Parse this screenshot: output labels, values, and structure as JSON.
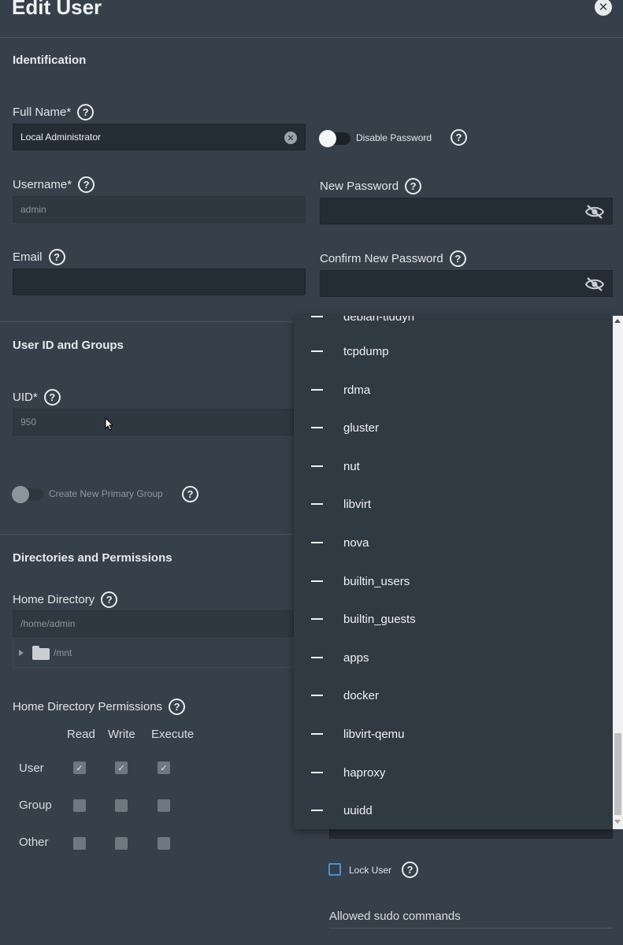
{
  "header": {
    "title": "Edit User"
  },
  "identification": {
    "section_title": "Identification",
    "full_name_label": "Full Name",
    "full_name_value": "Local Administrator",
    "username_label": "Username",
    "username_value": "admin",
    "email_label": "Email",
    "email_value": "",
    "disable_password_label": "Disable Password",
    "new_password_label": "New Password",
    "confirm_password_label": "Confirm New Password",
    "required_marker": "*"
  },
  "user_id_groups": {
    "section_title": "User ID and Groups",
    "uid_label": "UID",
    "uid_value": "950",
    "create_primary_group_label": "Create New Primary Group"
  },
  "directories": {
    "section_title": "Directories and Permissions",
    "home_dir_label": "Home Directory",
    "home_dir_value": "/home/admin",
    "tree_root": "/mnt",
    "permissions_label": "Home Directory Permissions",
    "columns": [
      "Read",
      "Write",
      "Execute"
    ],
    "rows": [
      {
        "name": "User",
        "checked": [
          true,
          true,
          true
        ]
      },
      {
        "name": "Group",
        "checked": [
          false,
          false,
          false
        ]
      },
      {
        "name": "Other",
        "checked": [
          false,
          false,
          false
        ]
      }
    ]
  },
  "right_column": {
    "lock_user_label": "Lock User",
    "sudo_label": "Allowed sudo commands"
  },
  "groups_dropdown": {
    "partial_top_item": "debian-tludyh",
    "items": [
      "tcpdump",
      "rdma",
      "gluster",
      "nut",
      "libvirt",
      "nova",
      "builtin_users",
      "builtin_guests",
      "apps",
      "docker",
      "libvirt-qemu",
      "haproxy",
      "uuidd"
    ]
  },
  "icons": {
    "help": "?",
    "close": "✕",
    "checkmark": "✓",
    "clear": "✕"
  },
  "colors": {
    "background": "#36404a",
    "input_bg": "#242c34",
    "dropdown_bg": "#303a43",
    "lock_checkbox_border": "#4a8fd6"
  }
}
